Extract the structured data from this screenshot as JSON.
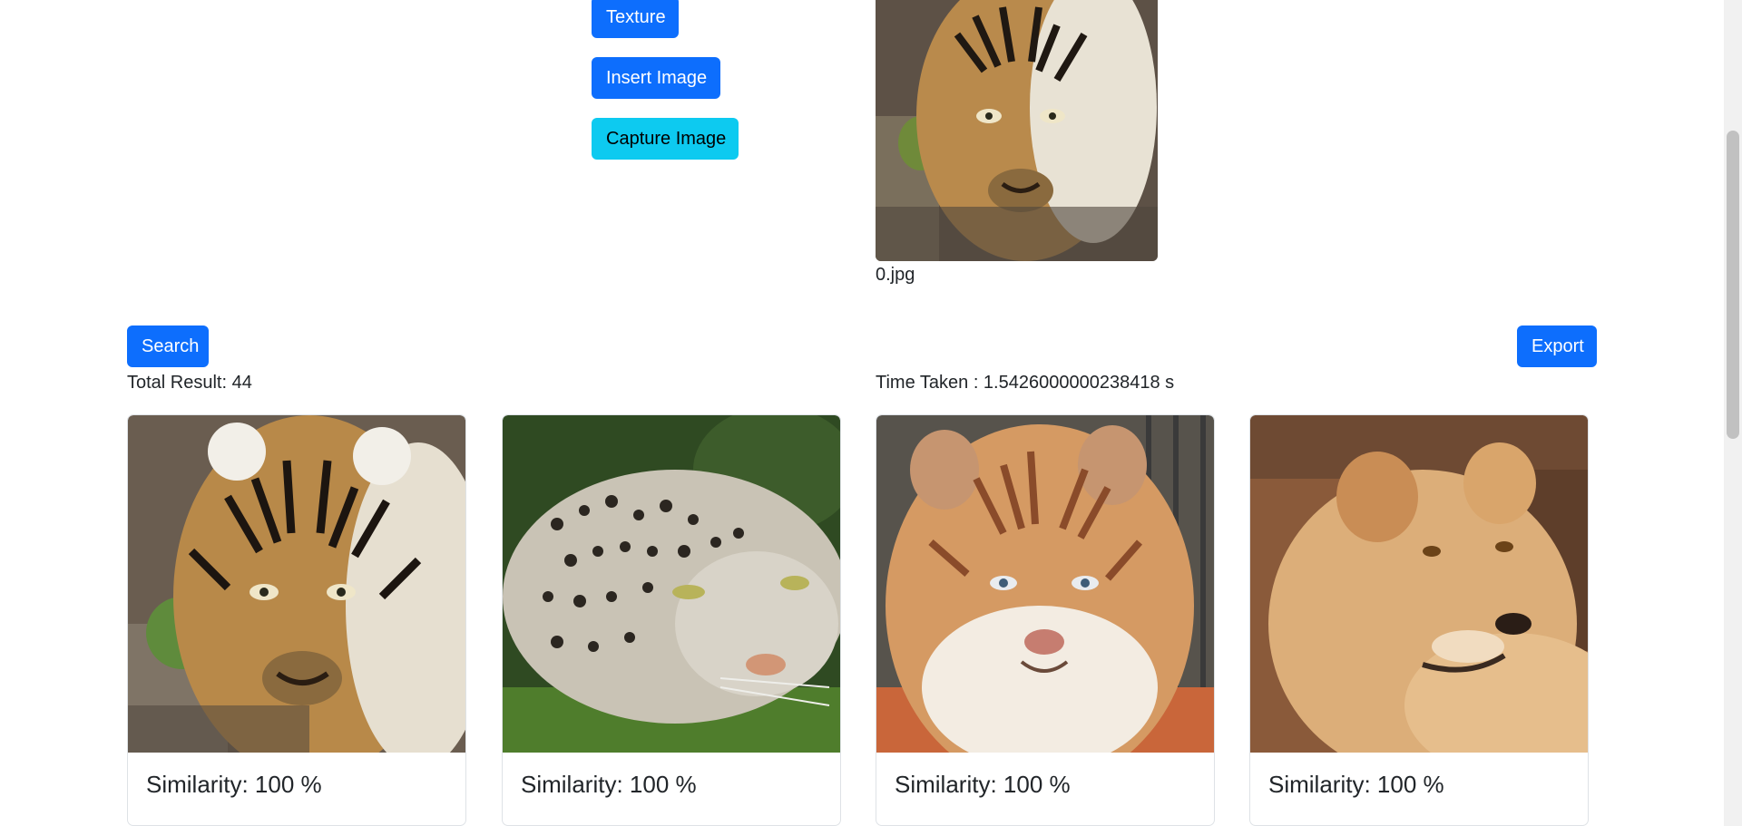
{
  "buttons": {
    "texture": "Texture",
    "insert_image": "Insert Image",
    "capture_image": "Capture Image",
    "search": "Search",
    "export": "Export"
  },
  "query": {
    "filename": "0.jpg"
  },
  "results": {
    "total": "Total Result: 44",
    "time_taken": "Time Taken : 1.5426000000238418 s",
    "cards": [
      {
        "caption": "Similarity: 100 %"
      },
      {
        "caption": "Similarity: 100 %"
      },
      {
        "caption": "Similarity: 100 %"
      },
      {
        "caption": "Similarity: 100 %"
      }
    ]
  },
  "colors": {
    "primary": "#0d6efd",
    "info": "#0dcaf0"
  }
}
